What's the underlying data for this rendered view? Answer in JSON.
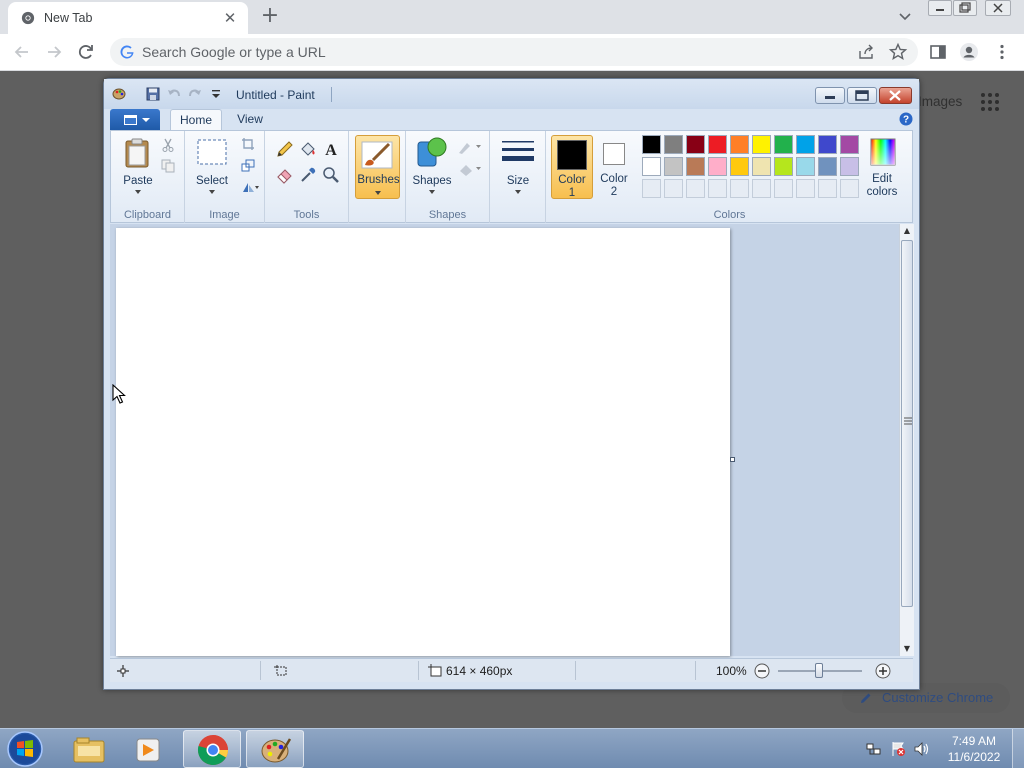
{
  "browser": {
    "tab_title": "New Tab",
    "omnibox_placeholder": "Search Google or type a URL",
    "page_images_link": "Images",
    "customize_label": "Customize Chrome"
  },
  "paint": {
    "window_title": "Untitled - Paint",
    "ribbon_tabs": [
      "Home",
      "View"
    ],
    "groups": {
      "clipboard": "Clipboard",
      "image": "Image",
      "tools": "Tools",
      "shapes": "Shapes",
      "colors": "Colors"
    },
    "buttons": {
      "paste": "Paste",
      "select": "Select",
      "brushes": "Brushes",
      "shapes": "Shapes",
      "size": "Size",
      "color1_line1": "Color",
      "color1_line2": "1",
      "color2_line1": "Color",
      "color2_line2": "2",
      "edit_colors_line1": "Edit",
      "edit_colors_line2": "colors"
    },
    "color1": "#000000",
    "color2": "#ffffff",
    "palette_row1": [
      "#000000",
      "#7f7f7f",
      "#880015",
      "#ed1c24",
      "#ff7f27",
      "#fff200",
      "#22b14c",
      "#00a2e8",
      "#3f48cc",
      "#a349a4"
    ],
    "palette_row2": [
      "#ffffff",
      "#c3c3c3",
      "#b97a57",
      "#ffaec9",
      "#ffc90e",
      "#efe4b0",
      "#b5e61d",
      "#99d9ea",
      "#7092be",
      "#c8bfe7"
    ],
    "status": {
      "canvas_size": "614 × 460px",
      "zoom": "100%"
    }
  },
  "taskbar": {
    "time": "7:49 AM",
    "date": "11/6/2022"
  }
}
